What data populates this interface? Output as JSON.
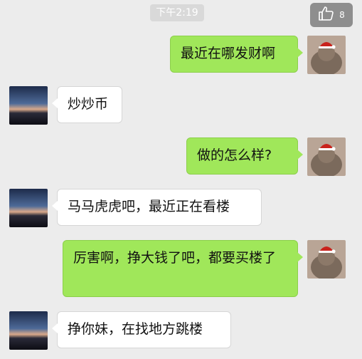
{
  "header": {
    "timestamp": "下午2:19",
    "like_badge": {
      "icon": "thumbs-up-icon",
      "count": "8"
    }
  },
  "chat": {
    "messages": [
      {
        "direction": "outgoing",
        "text": "最近在哪发财啊"
      },
      {
        "direction": "incoming",
        "text": "炒炒币"
      },
      {
        "direction": "outgoing",
        "text": "做的怎么样?"
      },
      {
        "direction": "incoming",
        "text": "马马虎虎吧，最近正在看楼"
      },
      {
        "direction": "outgoing",
        "text": "厉害啊，挣大钱了吧，都要买楼了"
      },
      {
        "direction": "incoming",
        "text": "挣你妹，在找地方跳楼"
      }
    ]
  },
  "colors": {
    "background": "#ececec",
    "outgoing_bubble": "#a0e75a",
    "incoming_bubble": "#ffffff",
    "badge": "#8e8e8e"
  }
}
